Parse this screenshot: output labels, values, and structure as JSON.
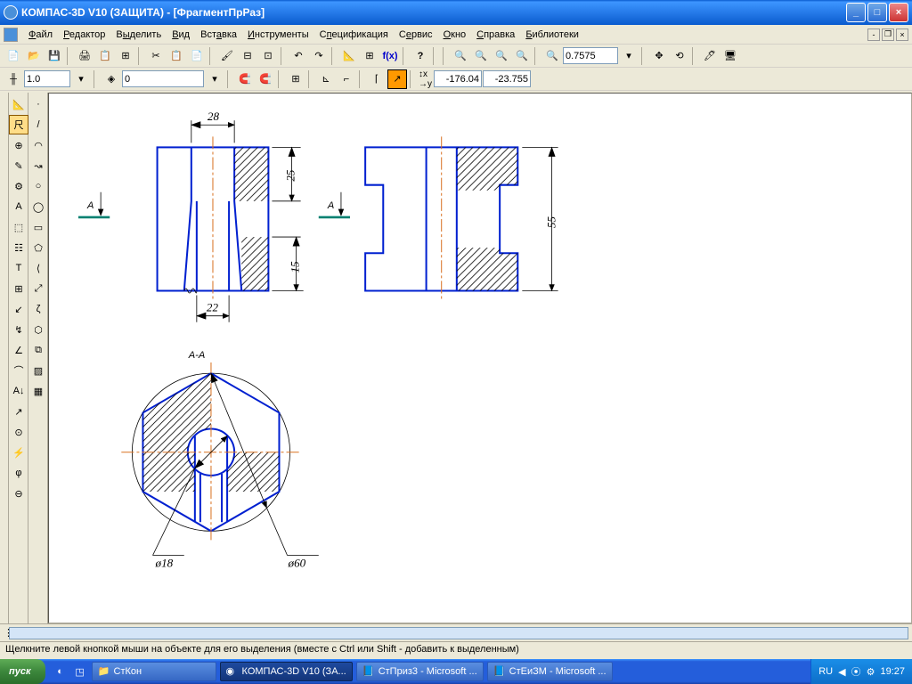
{
  "window": {
    "title": "КОМПАС-3D V10 (ЗАЩИТА) - [ФрагментПрРаз]"
  },
  "menu": {
    "file": "Файл",
    "editor": "Редактор",
    "select": "Выделить",
    "view": "Вид",
    "insert": "Вставка",
    "tools": "Инструменты",
    "spec": "Спецификация",
    "service": "Сервис",
    "window": "Окно",
    "help": "Справка",
    "libs": "Библиотеки"
  },
  "toolbar": {
    "zoom": "0.7575"
  },
  "toolbar2": {
    "style": "1.0",
    "layer": "0",
    "x": "-176.04",
    "y": "-23.755"
  },
  "status": {
    "text": "Щелкните левой кнопкой мыши на объекте для его выделения (вместе с Ctrl или Shift - добавить к выделенным)"
  },
  "taskbar": {
    "start": "пуск",
    "btn1": "СтКон",
    "btn2": "КОМПАС-3D V10 (ЗА...",
    "btn3": "СтПриз3 - Microsoft ...",
    "btn4": "СтЕиЗМ - Microsoft ...",
    "lang": "RU",
    "time": "19:27"
  },
  "drawing": {
    "dim28": "28",
    "dim22": "22",
    "dim25": "25",
    "dim15": "15",
    "dim55": "55",
    "section": "А-А",
    "labelA": "А",
    "labelA2": "А",
    "dia18": "ø18",
    "dia60": "ø60"
  }
}
